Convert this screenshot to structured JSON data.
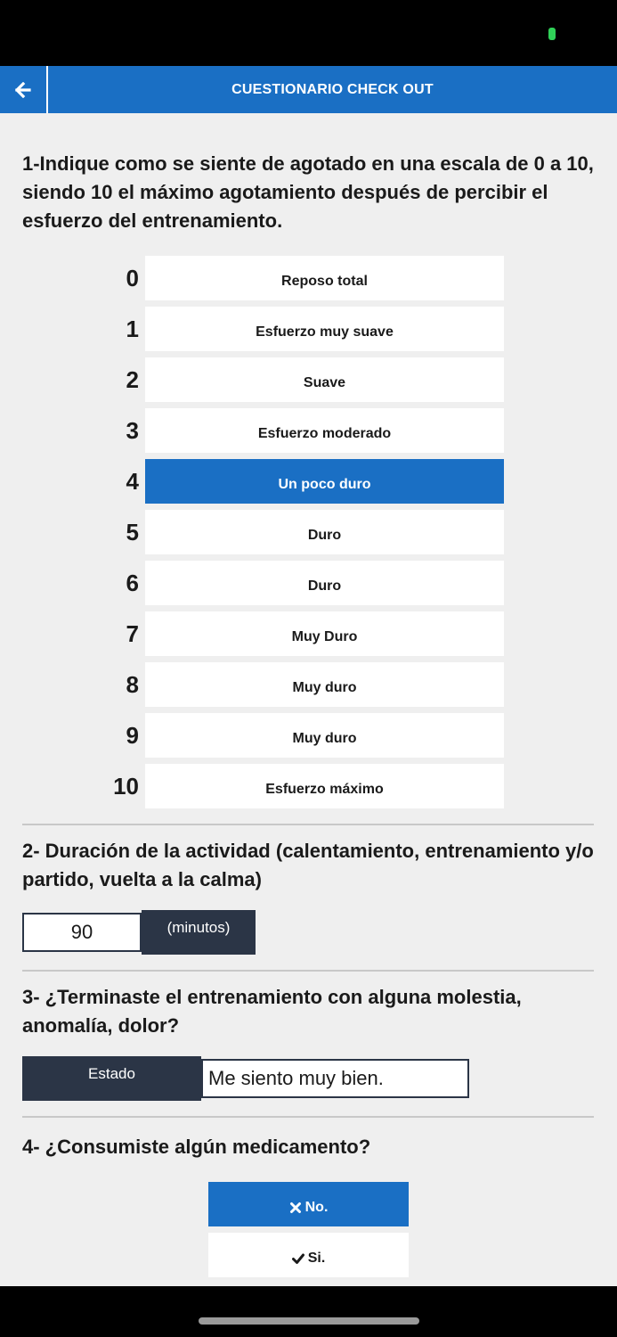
{
  "header": {
    "title": "CUESTIONARIO CHECK OUT"
  },
  "q1": {
    "title": "1-Indique como se siente de agotado en una escala de 0 a 10, siendo 10 el máximo agotamiento después de percibir el esfuerzo del entrenamiento.",
    "selected_index": 4,
    "options": [
      {
        "num": "0",
        "label": "Reposo total"
      },
      {
        "num": "1",
        "label": "Esfuerzo muy suave"
      },
      {
        "num": "2",
        "label": "Suave"
      },
      {
        "num": "3",
        "label": "Esfuerzo moderado"
      },
      {
        "num": "4",
        "label": "Un poco duro"
      },
      {
        "num": "5",
        "label": "Duro"
      },
      {
        "num": "6",
        "label": "Duro"
      },
      {
        "num": "7",
        "label": "Muy Duro"
      },
      {
        "num": "8",
        "label": "Muy duro"
      },
      {
        "num": "9",
        "label": "Muy duro"
      },
      {
        "num": "10",
        "label": "Esfuerzo máximo"
      }
    ]
  },
  "q2": {
    "title": "2- Duración de la actividad (calentamiento, entrenamiento y/o partido, vuelta a la calma)",
    "value": "90",
    "unit": "(minutos)"
  },
  "q3": {
    "title": "3- ¿Terminaste el entrenamiento con alguna molestia, anomalía, dolor?",
    "tag": "Estado",
    "value": "Me siento muy bien."
  },
  "q4": {
    "title": "4- ¿Consumiste algún medicamento?",
    "no_label": "No.",
    "yes_label": "Si.",
    "selected": "no"
  },
  "colors": {
    "accent": "#1a6fc4",
    "dark": "#2b3546",
    "background": "#efefef"
  }
}
